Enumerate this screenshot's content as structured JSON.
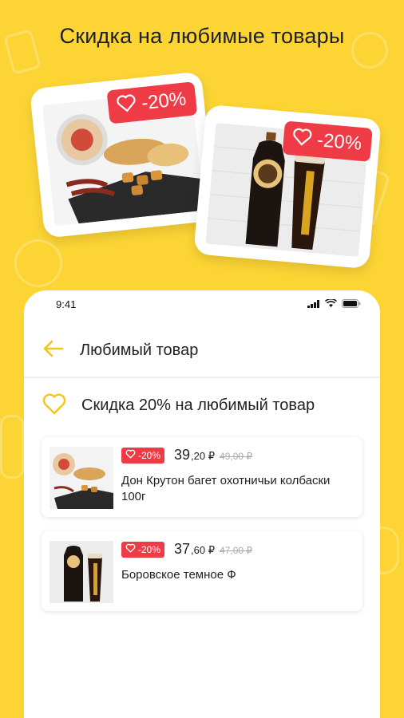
{
  "headline": "Скидка на любимые товары",
  "promo_cards": [
    {
      "discount": "-20%",
      "icon": "heart-icon"
    },
    {
      "discount": "-20%",
      "icon": "heart-icon"
    }
  ],
  "phone": {
    "status_bar": {
      "time": "9:41",
      "icons": [
        "signal-icon",
        "wifi-icon",
        "battery-icon"
      ]
    },
    "app_bar": {
      "back_icon": "arrow-left-icon",
      "title": "Любимый товар"
    },
    "section": {
      "icon": "heart-icon",
      "title": "Скидка 20% на любимый товар"
    },
    "products": [
      {
        "discount": "-20%",
        "price_main": "39",
        "price_frac": ",20 ₽",
        "price_old": "49,00 ₽",
        "name": "Дон Крутон багет охотничьи колбаски 100г"
      },
      {
        "discount": "-20%",
        "price_main": "37",
        "price_frac": ",60 ₽",
        "price_old": "47,00 ₽",
        "name": "Боровское темное Ф"
      }
    ]
  },
  "colors": {
    "background": "#FCD535",
    "badge": "#EE3B46",
    "accent": "#F5C518"
  }
}
